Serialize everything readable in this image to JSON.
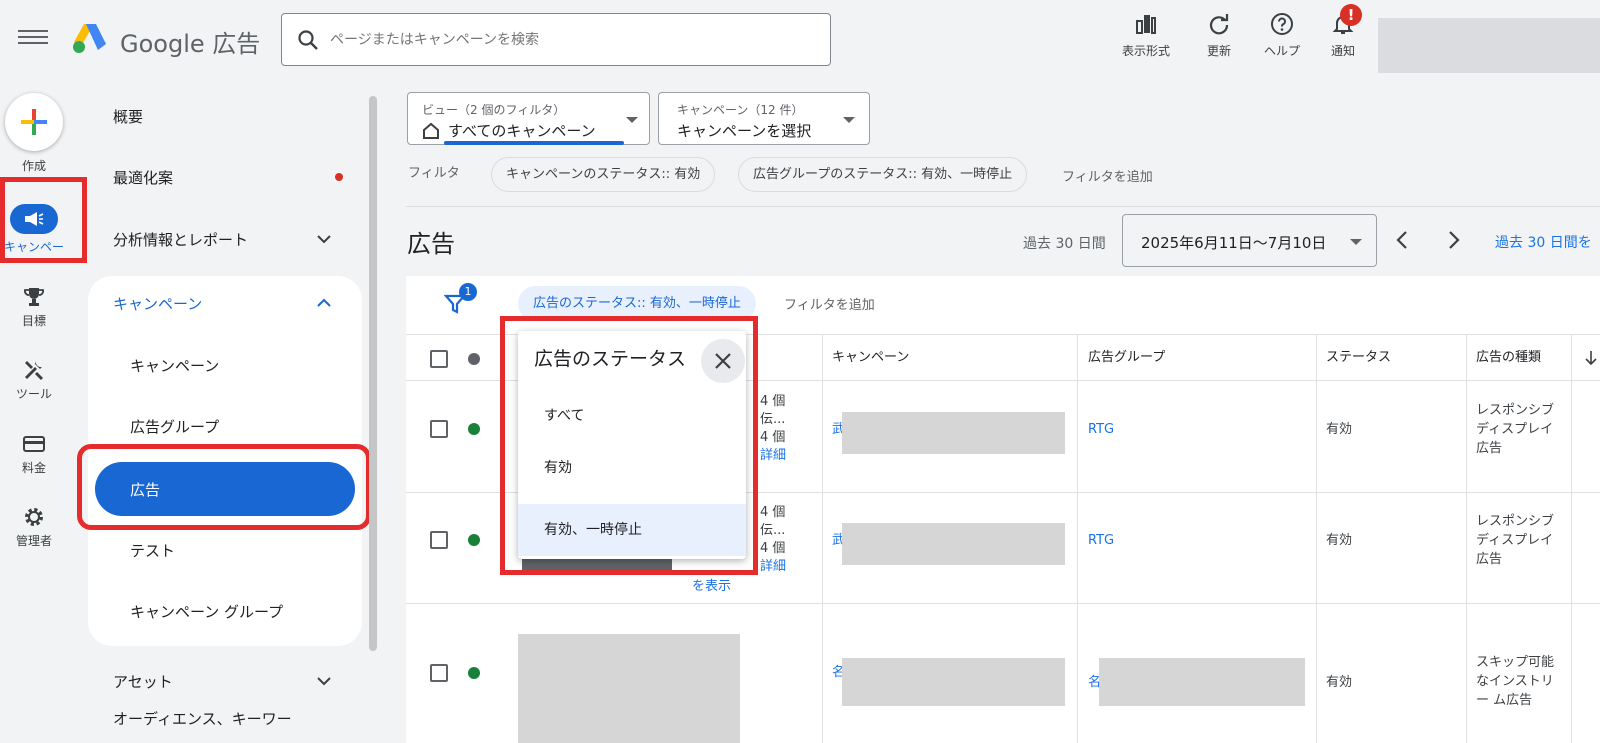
{
  "header": {
    "brand": "Google 広告",
    "search_placeholder": "ページまたはキャンペーンを検索",
    "actions": [
      {
        "label": "表示形式",
        "icon": "bar-chart-icon"
      },
      {
        "label": "更新",
        "icon": "refresh-icon"
      },
      {
        "label": "ヘルプ",
        "icon": "help-icon"
      },
      {
        "label": "通知",
        "icon": "bell-icon"
      }
    ],
    "notification_badge": "!"
  },
  "rail": {
    "create": "作成",
    "campaigns": "キャンペー",
    "goals": "目標",
    "tools": "ツール",
    "billing": "料金",
    "admin": "管理者"
  },
  "sidenav": {
    "overview": "概要",
    "recommendations": "最適化案",
    "insights": "分析情報とレポート",
    "campaigns_group": "キャンペーン",
    "sub": [
      "キャンペーン",
      "広告グループ",
      "広告",
      "テスト",
      "キャンペーン グループ"
    ],
    "assets": "アセット",
    "audiences": "オーディエンス、キーワー"
  },
  "toolbar": {
    "view_small": "ビュー（2 個のフィルタ）",
    "view_value": "すべてのキャンペーン",
    "campaign_small": "キャンペーン（12 件）",
    "campaign_value": "キャンペーンを選択",
    "filter_label": "フィルタ",
    "chip1": "キャンペーンのステータス:: 有効",
    "chip2": "広告グループのステータス:: 有効、一時停止",
    "add_filter": "フィルタを追加"
  },
  "page": {
    "title": "広告",
    "range_label": "過去 30 日間",
    "date_range": "2025年6月11日～7月10日",
    "range_link": "過去 30 日間を"
  },
  "table": {
    "filter_badge": "1",
    "active_filter": "広告のステータス:: 有効、一時停止",
    "add_filter": "フィルタを追加",
    "columns": {
      "campaign": "キャンペーン",
      "adgroup": "広告グループ",
      "status": "ステータス",
      "type": "広告の種類"
    },
    "rows": [
      {
        "frag": [
          "4 個",
          "伝...",
          "4 個",
          "詳細"
        ],
        "campaign_prefix": "武",
        "adgroup": "RTG",
        "status": "有効",
        "type": "レスポンシブ ディスプレイ 広告"
      },
      {
        "frag": [
          "4 個",
          "伝...",
          "4 個",
          "詳細"
        ],
        "campaign_prefix": "武",
        "adgroup": "RTG",
        "status": "有効",
        "type": "レスポンシブ ディスプレイ 広告",
        "extra": "を表示"
      },
      {
        "campaign_prefix": "名",
        "adgroup_prefix": "名",
        "status": "有効",
        "type": "スキップ可能 なインストリー ム広告"
      }
    ]
  },
  "popup": {
    "title": "広告のステータス",
    "options": [
      "すべて",
      "有効",
      "有効、一時停止"
    ],
    "selected_index": 2
  },
  "colors": {
    "accent": "#1a73e8",
    "highlight": "#e52b2b",
    "active_pill": "#1967d2",
    "status_ok": "#188038"
  }
}
